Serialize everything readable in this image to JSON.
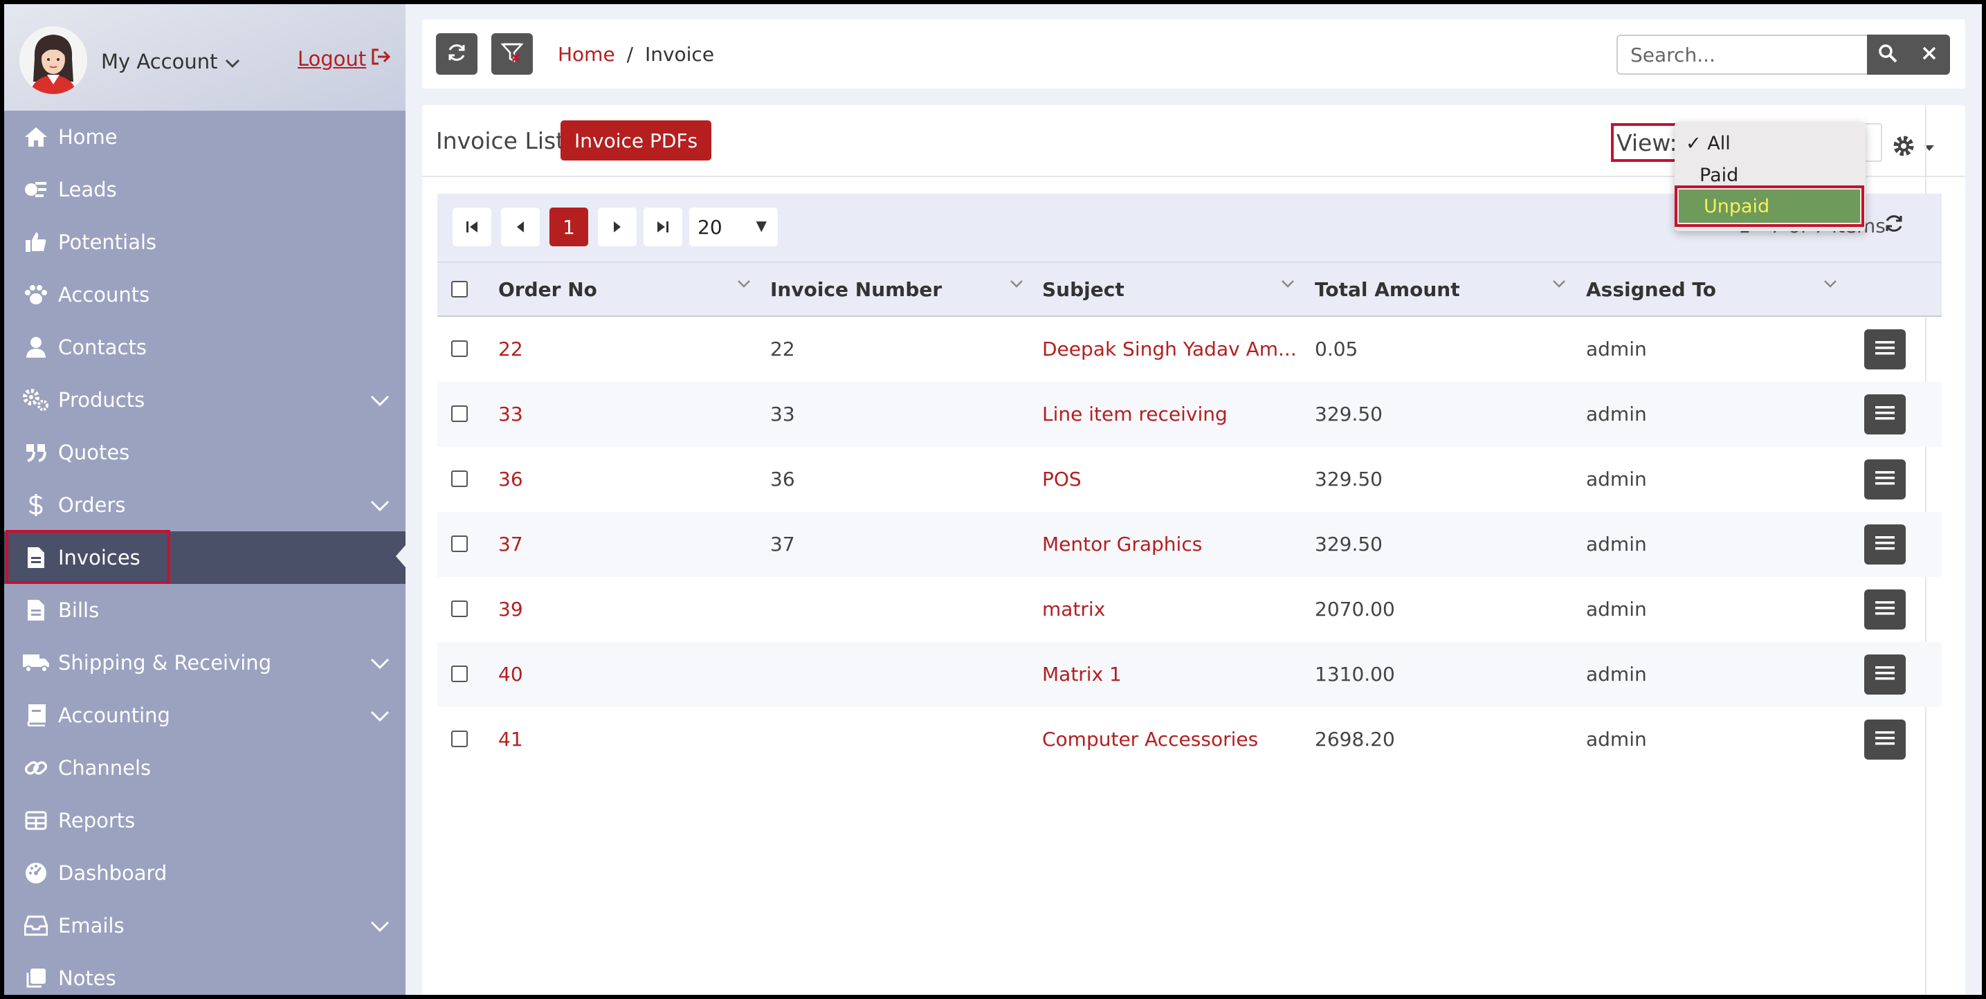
{
  "sidebar": {
    "account_label": "My Account",
    "logout_label": "Logout",
    "items": [
      {
        "label": "Home",
        "icon": "home-icon",
        "has_children": false
      },
      {
        "label": "Leads",
        "icon": "leads-icon",
        "has_children": false
      },
      {
        "label": "Potentials",
        "icon": "thumbs-up-icon",
        "has_children": false
      },
      {
        "label": "Accounts",
        "icon": "paw-icon",
        "has_children": false
      },
      {
        "label": "Contacts",
        "icon": "user-icon",
        "has_children": false
      },
      {
        "label": "Products",
        "icon": "gears-icon",
        "has_children": true
      },
      {
        "label": "Quotes",
        "icon": "quote-icon",
        "has_children": false
      },
      {
        "label": "Orders",
        "icon": "dollar-icon",
        "has_children": true
      },
      {
        "label": "Invoices",
        "icon": "file-icon",
        "has_children": false,
        "active": true
      },
      {
        "label": "Bills",
        "icon": "file-icon",
        "has_children": false
      },
      {
        "label": "Shipping & Receiving",
        "icon": "truck-icon",
        "has_children": true
      },
      {
        "label": "Accounting",
        "icon": "book-icon",
        "has_children": true
      },
      {
        "label": "Channels",
        "icon": "link-icon",
        "has_children": false
      },
      {
        "label": "Reports",
        "icon": "table-icon",
        "has_children": false
      },
      {
        "label": "Dashboard",
        "icon": "dashboard-icon",
        "has_children": false
      },
      {
        "label": "Emails",
        "icon": "inbox-icon",
        "has_children": true
      },
      {
        "label": "Notes",
        "icon": "notes-icon",
        "has_children": false
      }
    ]
  },
  "topbar": {
    "breadcrumb_home": "Home",
    "breadcrumb_sep": "/",
    "breadcrumb_current": "Invoice",
    "search_placeholder": "Search..."
  },
  "panel": {
    "title": "Invoice List",
    "pdf_button": "Invoice PDFs",
    "view_label": "View:",
    "view_options": [
      {
        "label": "All",
        "checked": true
      },
      {
        "label": "Paid",
        "checked": false
      },
      {
        "label": "Unpaid",
        "checked": false,
        "highlighted": true
      }
    ],
    "check_mark": "✓"
  },
  "pager": {
    "current_page": "1",
    "page_size": "20",
    "info": "1 - 7 of 7 items"
  },
  "table": {
    "columns": [
      "Order No",
      "Invoice Number",
      "Subject",
      "Total Amount",
      "Assigned To"
    ],
    "rows": [
      {
        "order_no": "22",
        "invoice_number": "22",
        "subject": "Deepak Singh Yadav Am...",
        "total": "0.05",
        "assigned": "admin"
      },
      {
        "order_no": "33",
        "invoice_number": "33",
        "subject": "Line item receiving",
        "total": "329.50",
        "assigned": "admin"
      },
      {
        "order_no": "36",
        "invoice_number": "36",
        "subject": "POS",
        "total": "329.50",
        "assigned": "admin"
      },
      {
        "order_no": "37",
        "invoice_number": "37",
        "subject": "Mentor Graphics",
        "total": "329.50",
        "assigned": "admin"
      },
      {
        "order_no": "39",
        "invoice_number": "",
        "subject": "matrix",
        "total": "2070.00",
        "assigned": "admin"
      },
      {
        "order_no": "40",
        "invoice_number": "",
        "subject": "Matrix 1",
        "total": "1310.00",
        "assigned": "admin"
      },
      {
        "order_no": "41",
        "invoice_number": "",
        "subject": "Computer Accessories",
        "total": "2698.20",
        "assigned": "admin"
      }
    ]
  },
  "colors": {
    "brand_red": "#b51f1f",
    "sidebar_bg": "#9aa2bf",
    "sidebar_active": "#4a5068",
    "highlight_box": "#c8102e",
    "hover_option": "#6e9a5c"
  }
}
